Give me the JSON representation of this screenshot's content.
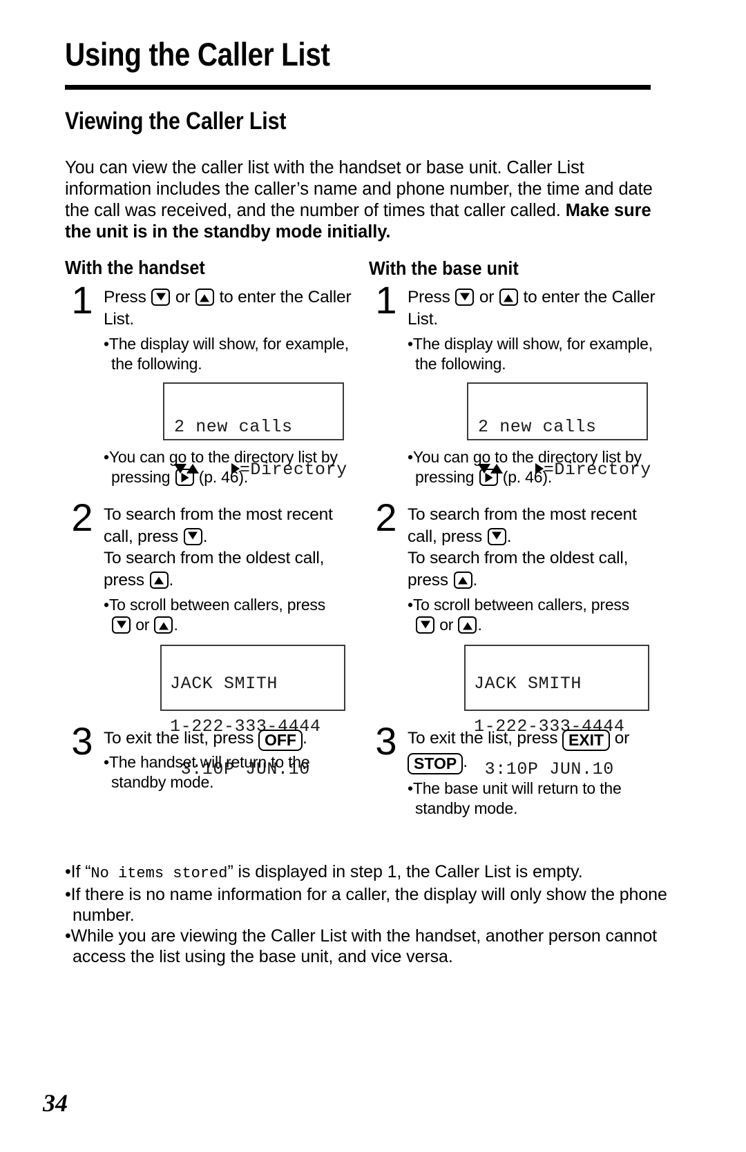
{
  "document": {
    "chapter_title": "Using the Caller List",
    "section_title": "Viewing the Caller List",
    "page_number": "34"
  },
  "intro": {
    "text": "You can view the caller list with the handset or base unit. Caller List information includes the caller’s name and phone number, the time and date the call was received, and the number of times that caller called.",
    "bold_text": "Make sure the unit is in the standby mode initially."
  },
  "columns": {
    "handset": {
      "heading": "With the handset",
      "steps": [
        {
          "number": "1",
          "text_before_keys": "Press",
          "text_between_keys": "or",
          "text_after_keys": "to enter the Caller List.",
          "bullets": [
            "The display will show, for example, the following.",
            "You can go to the directory list by pressing"
          ],
          "bullet2_suffix": "(p. 46)."
        },
        {
          "number": "2",
          "line1": "To search from the most recent call, press",
          "line1_suffix": ".",
          "line2": "To search from the oldest call, press",
          "line2_suffix": ".",
          "bullet": "To scroll between callers, press",
          "bullet_mid": "or",
          "bullet_suffix": "."
        },
        {
          "number": "3",
          "text": "To exit the list, press",
          "key_label": "OFF",
          "text_suffix": ".",
          "bullet": "The handset will return to the standby mode."
        }
      ],
      "display1": {
        "line1": "2 new calls",
        "line2_right": "=Directory"
      },
      "display2": {
        "line1": "JACK SMITH",
        "line2": "1-222-333-4444",
        "line3": " 3:10P JUN.10"
      }
    },
    "base_unit": {
      "heading": "With the base unit",
      "steps": [
        {
          "number": "1",
          "text_before_keys": "Press",
          "text_between_keys": "or",
          "text_after_keys": "to enter the Caller List.",
          "bullets": [
            "The display will show, for example, the following.",
            "You can go to the directory list by pressing"
          ],
          "bullet2_suffix": "(p. 46)."
        },
        {
          "number": "2",
          "line1": "To search from the most recent call, press",
          "line1_suffix": ".",
          "line2": "To search from the oldest call, press",
          "line2_suffix": ".",
          "bullet": "To scroll between callers, press",
          "bullet_mid": "or",
          "bullet_suffix": "."
        },
        {
          "number": "3",
          "text": "To exit the list, press",
          "key_label": "EXIT",
          "text_mid": "or",
          "key_label2": "STOP",
          "text_suffix": ".",
          "bullet": "The base unit will return to the standby mode."
        }
      ],
      "display1": {
        "line1": "2 new calls",
        "line2_right": "=Directory"
      },
      "display2": {
        "line1": "JACK SMITH",
        "line2": "1-222-333-4444",
        "line3": " 3:10P JUN.10"
      }
    }
  },
  "notes": [
    {
      "prefix": "If “",
      "mono": "No items stored",
      "suffix": "” is displayed in step 1, the Caller List is empty."
    },
    {
      "prefix": "",
      "mono": "",
      "suffix": "If there is no name information for a caller, the display will only show the phone number."
    },
    {
      "prefix": "",
      "mono": "",
      "suffix": "While you are viewing the Caller List with the handset, another person cannot access the list using the base unit, and vice versa."
    }
  ],
  "colors": {
    "text": "#000000",
    "background": "#ffffff",
    "lcd_border": "#3a3a3a"
  }
}
